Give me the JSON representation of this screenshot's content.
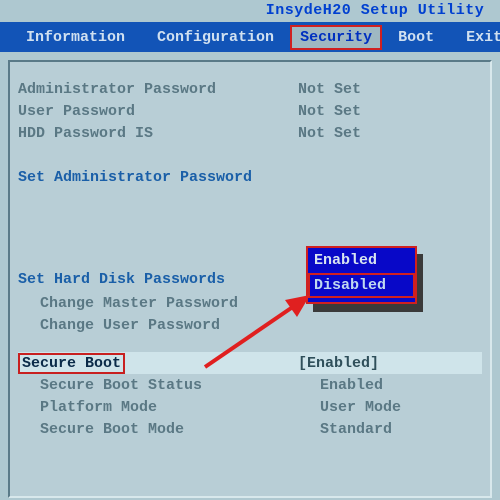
{
  "utility_title": "InsydeH20 Setup Utility",
  "menu": {
    "items": [
      "Information",
      "Configuration",
      "Security",
      "Boot",
      "Exit"
    ],
    "active_index": 2
  },
  "passwords": {
    "admin_label": "Administrator Password",
    "admin_value": "Not Set",
    "user_label": "User Password",
    "user_value": "Not Set",
    "hdd_label": "HDD Password IS",
    "hdd_value": "Not Set"
  },
  "set_admin": "Set Administrator Password",
  "set_hdd": "Set Hard Disk Passwords",
  "change_master": "Change Master Password",
  "change_user": "Change User Password",
  "secure_boot": {
    "label": "Secure Boot",
    "value": "[Enabled]",
    "status_label": "Secure Boot Status",
    "status_value": "Enabled",
    "platform_label": "Platform Mode",
    "platform_value": "User Mode",
    "mode_label": "Secure Boot Mode",
    "mode_value": "Standard"
  },
  "popup": {
    "options": [
      "Enabled",
      "Disabled"
    ],
    "active_index": 1
  }
}
